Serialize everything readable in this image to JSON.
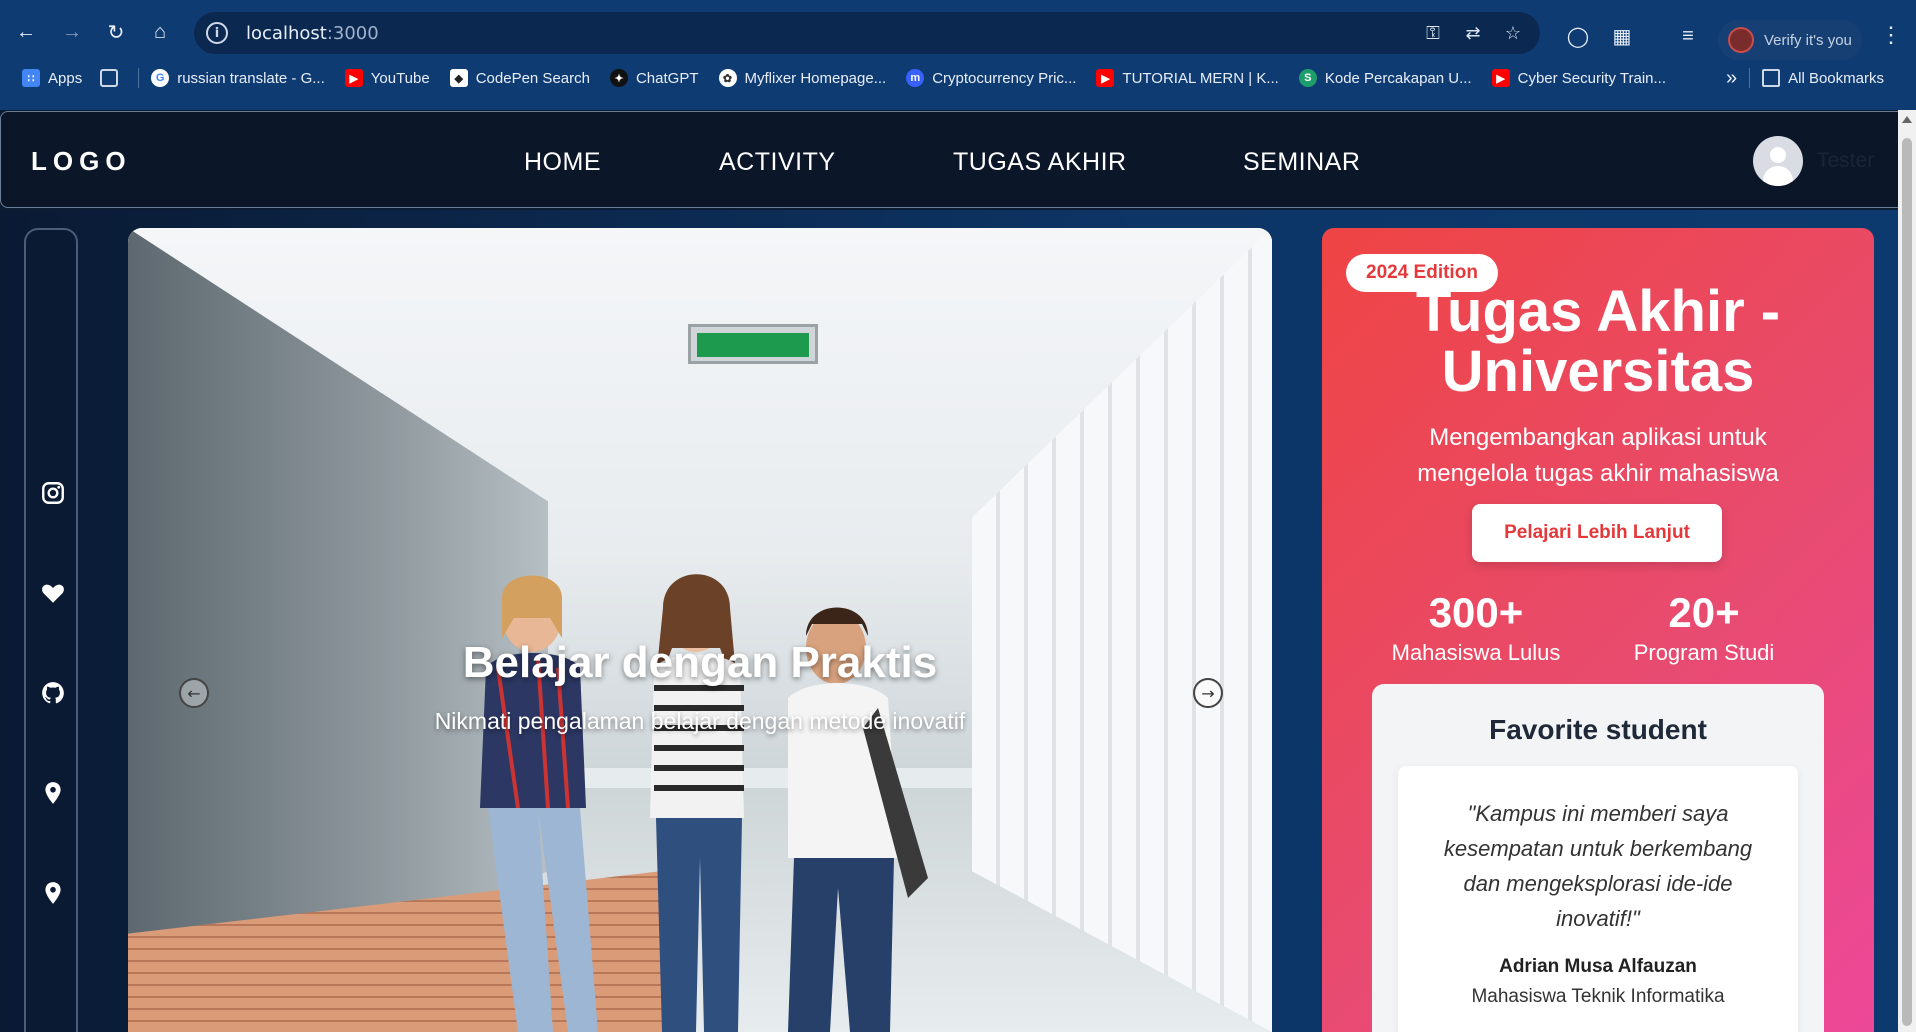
{
  "browser": {
    "url_host": "localhost",
    "url_port": ":3000",
    "profile_label": "Verify it's you",
    "bookmarks": [
      {
        "label": "Apps",
        "icon": "apps-grid-icon",
        "color": "#4285f4"
      },
      {
        "label": "",
        "icon": "tab-groups-icon",
        "color": "#9fb2cc"
      },
      {
        "label": "russian translate - G...",
        "icon": "google-icon",
        "color": "#4285f4"
      },
      {
        "label": "YouTube",
        "icon": "youtube-icon",
        "color": "#ff0000"
      },
      {
        "label": "CodePen Search",
        "icon": "codepen-icon",
        "color": "#222222"
      },
      {
        "label": "ChatGPT",
        "icon": "chatgpt-icon",
        "color": "#111111"
      },
      {
        "label": "Myflixer Homepage...",
        "icon": "myflixer-icon",
        "color": "#333333"
      },
      {
        "label": "Cryptocurrency Pric...",
        "icon": "coinmarketcap-icon",
        "color": "#3861fb"
      },
      {
        "label": "TUTORIAL MERN | K...",
        "icon": "youtube-icon",
        "color": "#ff0000"
      },
      {
        "label": "Kode Percakapan U...",
        "icon": "s-icon",
        "color": "#1e9e6a"
      },
      {
        "label": "Cyber Security Train...",
        "icon": "youtube-icon",
        "color": "#ff0000"
      }
    ],
    "overflow_label": "»",
    "all_bookmarks": "All Bookmarks"
  },
  "header": {
    "logo": "LOGO",
    "nav": [
      "HOME",
      "ACTIVITY",
      "TUGAS AKHIR",
      "SEMINAR"
    ],
    "user_name": "Tester"
  },
  "sidebar": {
    "icons": [
      "instagram-icon",
      "heart-icon",
      "github-icon",
      "location-pin-icon",
      "location-pin-icon"
    ]
  },
  "hero": {
    "title": "Belajar dengan Praktis",
    "subtitle": "Nikmati pengalaman belajar dengan metode inovatif",
    "prev": "←",
    "next": "→"
  },
  "promo": {
    "badge": "2024 Edition",
    "title_line1": "Tugas Akhir -",
    "title_line2": "Universitas",
    "description": "Mengembangkan aplikasi untuk mengelola tugas akhir mahasiswa",
    "cta": "Pelajari Lebih Lanjut",
    "stats": [
      {
        "value": "300+",
        "label": "Mahasiswa Lulus"
      },
      {
        "value": "20+",
        "label": "Program Studi"
      }
    ],
    "favorite": {
      "heading": "Favorite student",
      "quote": "\"Kampus ini memberi saya kesempatan untuk berkembang dan mengeksplorasi ide-ide inovatif!\"",
      "author": "Adrian Musa Alfauzan",
      "role": "Mahasiswa Teknik Informatika"
    }
  },
  "colors": {
    "promo_start": "#ef4444",
    "promo_end": "#ec4899",
    "accent_text": "#e5383b"
  }
}
